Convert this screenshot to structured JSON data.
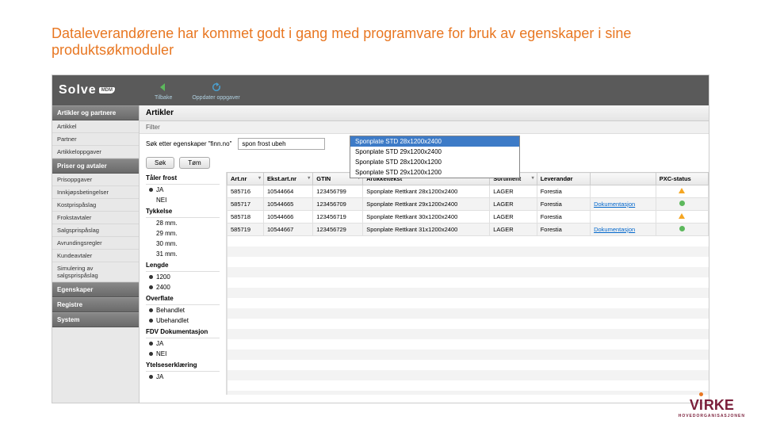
{
  "slide": {
    "title": "Dataleverandørene har kommet godt i gang med programvare for bruk av egenskaper i sine produktsøkmoduler"
  },
  "app": {
    "logo": "Solve",
    "logo_badge": "MDM",
    "top_actions": {
      "back": "Tilbake",
      "refresh": "Oppdater oppgaver"
    }
  },
  "sidebar": {
    "sections": [
      {
        "title": "Artikler og partnere",
        "items": [
          "Artikkel",
          "Partner",
          "Artikkeloppgaver"
        ]
      },
      {
        "title": "Priser og avtaler",
        "items": [
          "Prisoppgaver",
          "Innkjøpsbetingelser",
          "Kostprispåslag",
          "Frokstavtaler",
          "Salgsprispåslag",
          "Avrundingsregler",
          "Kundeavtaler",
          "Simulering av salgsprispåslag"
        ]
      },
      {
        "title": "Egenskaper",
        "items": []
      },
      {
        "title": "Registre",
        "items": []
      },
      {
        "title": "System",
        "items": []
      }
    ]
  },
  "content": {
    "header": "Artikler",
    "filter_label": "Filter",
    "search_label": "Søk etter egenskaper \"finn.no\"",
    "search_value": "spon frost ubeh",
    "dropdown": [
      "Sponplate STD 28x1200x2400",
      "Sponplate STD 29x1200x2400",
      "Sponplate STD 28x1200x1200",
      "Sponplate STD 29x1200x1200"
    ],
    "btn_search": "Søk",
    "btn_clear": "Tøm"
  },
  "filters": {
    "frost": {
      "head": "Tåler frost",
      "opts": [
        "JA",
        "NEI"
      ]
    },
    "thickness": {
      "head": "Tykkelse",
      "opts": [
        "28 mm.",
        "29 mm.",
        "30 mm.",
        "31 mm."
      ]
    },
    "length": {
      "head": "Lengde",
      "opts": [
        "1200",
        "2400"
      ]
    },
    "surface": {
      "head": "Overflate",
      "opts": [
        "Behandlet",
        "Ubehandlet"
      ]
    },
    "fdv": {
      "head": "FDV Dokumentasjon",
      "opts": [
        "JA",
        "NEI"
      ]
    },
    "ytelse": {
      "head": "Ytelseserklæring",
      "opts": [
        "JA"
      ]
    }
  },
  "table": {
    "cols": [
      "Art.nr",
      "Ekst.art.nr",
      "GTIN",
      "Artikkeltekst",
      "Sortiment",
      "Leverandør",
      "",
      "PXC-status"
    ],
    "rows": [
      {
        "art": "585716",
        "ekst": "10544664",
        "gtin": "123456799",
        "txt": "Sponplate Rettkant 28x1200x2400",
        "sort": "LAGER",
        "lev": "Forestia",
        "doc": "",
        "pxc": "tri"
      },
      {
        "art": "585717",
        "ekst": "10544665",
        "gtin": "123456709",
        "txt": "Sponplate Rettkant 29x1200x2400",
        "sort": "LAGER",
        "lev": "Forestia",
        "doc": "Dokumentasjon",
        "pxc": "grn"
      },
      {
        "art": "585718",
        "ekst": "10544666",
        "gtin": "123456719",
        "txt": "Sponplate Rettkant 30x1200x2400",
        "sort": "LAGER",
        "lev": "Forestia",
        "doc": "",
        "pxc": "tri"
      },
      {
        "art": "585719",
        "ekst": "10544667",
        "gtin": "123456729",
        "txt": "Sponplate Rettkant 31x1200x2400",
        "sort": "LAGER",
        "lev": "Forestia",
        "doc": "Dokumentasjon",
        "pxc": "grn"
      }
    ]
  },
  "virke": {
    "name": "VIRKE",
    "sub": "HOVEDORGANISASJONEN"
  }
}
